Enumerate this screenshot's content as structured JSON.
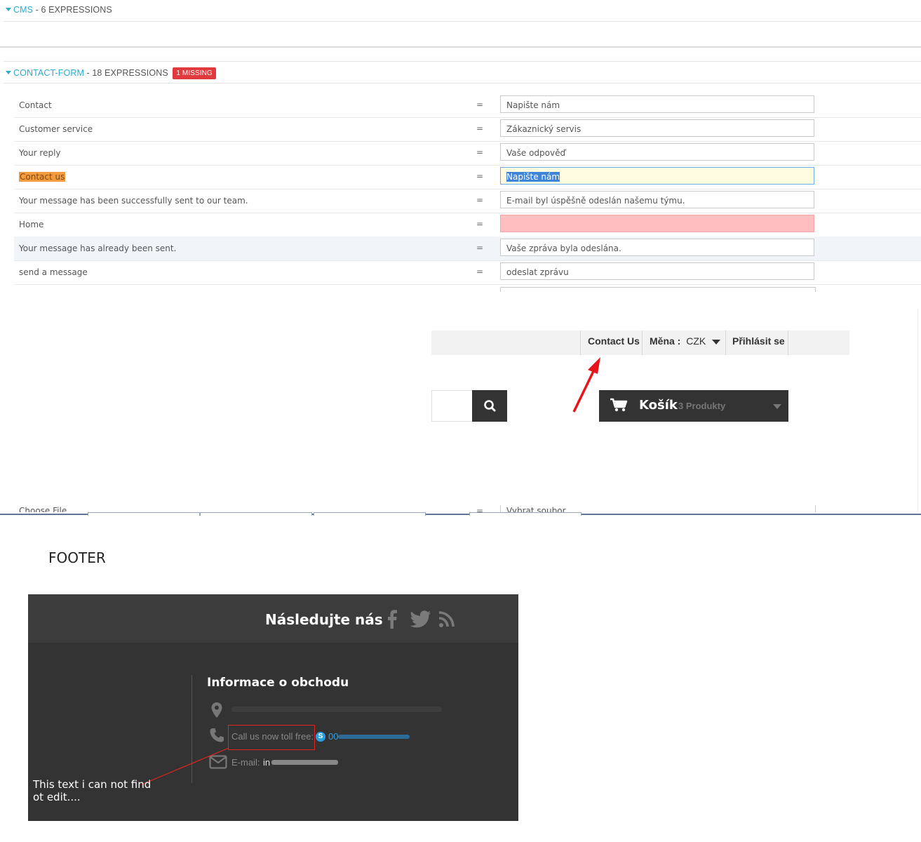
{
  "sections": {
    "cms": {
      "name": "CMS",
      "info": " - 6 EXPRESSIONS"
    },
    "contact_form": {
      "name": "CONTACT-FORM",
      "info": " - 18 EXPRESSIONS",
      "badge": "1 MISSING"
    }
  },
  "translations": [
    {
      "source": "Contact",
      "eq": "=",
      "value": "Napište nám"
    },
    {
      "source": "Customer service",
      "eq": "=",
      "value": "Zákaznický servis"
    },
    {
      "source": "Your reply",
      "eq": "=",
      "value": "Vaše odpověď"
    },
    {
      "source": "Contact us",
      "eq": "=",
      "value": "Napište nám"
    },
    {
      "source": "Your message has been successfully sent to our team.",
      "eq": "=",
      "value": "E-mail byl úspěšně odeslán našemu týmu."
    },
    {
      "source": "Home",
      "eq": "=",
      "value": ""
    },
    {
      "source": "Your message has already been sent.",
      "eq": "=",
      "value": "Vaše zpráva byla odeslána."
    },
    {
      "source": "send a message",
      "eq": "=",
      "value": "odeslat zprávu"
    }
  ],
  "partial_row": {
    "source": "Choose File",
    "eq": "=",
    "value": "Vybrat soubor"
  },
  "shop_nav": {
    "contact": "Contact Us",
    "currency_label": "Měna :",
    "currency_value": "CZK",
    "login": "Přihlásit se"
  },
  "cart": {
    "label": "Košík",
    "count": "3 Produkty"
  },
  "footer_heading": "FOOTER",
  "footer": {
    "follow": "Následujte nás",
    "info_title": "Informace o obchodu",
    "call_label": "Call us now toll free:",
    "phone_prefix": "00",
    "email_label": "E-mail:",
    "email_prefix": "in"
  },
  "annotation": "This text i can not find ot edit....",
  "colors": {
    "link": "#2eacce",
    "badge": "#e0393e",
    "highlight": "#f39c3d",
    "missing": "#ffbfc0",
    "footer_bg": "#333333",
    "arrow": "#e8141b"
  }
}
